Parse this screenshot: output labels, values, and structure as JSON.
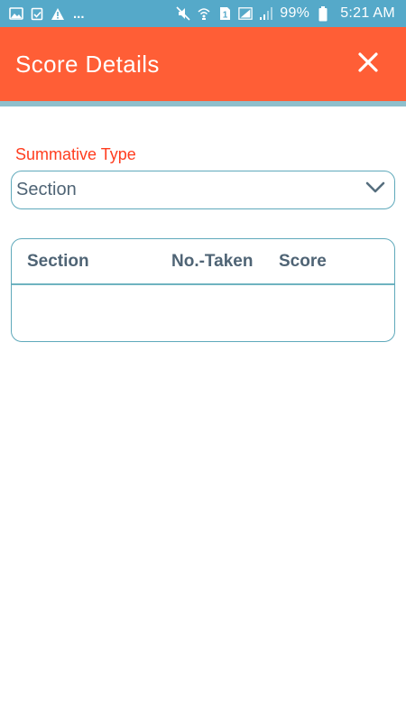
{
  "status_bar": {
    "left_icons": [
      "image-icon",
      "clipboard-icon",
      "warning-icon"
    ],
    "more_indicator": "...",
    "right_icons": [
      "mute-icon",
      "wifi-calling-icon",
      "sim-1-icon",
      "signal-icon",
      "signal-weak-icon"
    ],
    "battery_text": "99%",
    "time": "5:21 AM"
  },
  "app_bar": {
    "title": "Score Details",
    "close_icon": "close-icon"
  },
  "filter": {
    "label": "Summative Type",
    "selected_value": "Section",
    "dropdown_icon": "chevron-down-icon"
  },
  "table": {
    "headers": [
      "Section",
      "No.-Taken",
      "Score"
    ],
    "rows": []
  },
  "colors": {
    "status_bar": "#55a9c9",
    "app_bar": "#ff5e36",
    "label": "#ff3d1f",
    "border": "#5fa9bb",
    "text": "#4f6475"
  }
}
